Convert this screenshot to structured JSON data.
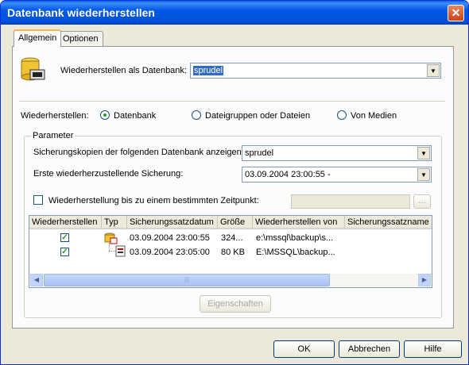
{
  "window": {
    "title": "Datenbank wiederherstellen",
    "close_glyph": "✕"
  },
  "tabs": [
    {
      "label": "Allgemein",
      "active": true
    },
    {
      "label": "Optionen",
      "active": false
    }
  ],
  "restore_as": {
    "label": "Wiederherstellen als Datenbank:",
    "value": "sprudel",
    "icon": "database-icon"
  },
  "restore_type": {
    "label": "Wiederherstellen:",
    "options": [
      {
        "label": "Datenbank",
        "selected": true
      },
      {
        "label": "Dateigruppen oder Dateien",
        "selected": false
      },
      {
        "label": "Von Medien",
        "selected": false
      }
    ]
  },
  "parameters": {
    "group_label": "Parameter",
    "show_backups_label": "Sicherungskopien der folgenden Datenbank anzeigen:",
    "show_backups_value": "sprudel",
    "first_backup_label": "Erste wiederherzustellende Sicherung:",
    "first_backup_value": "03.09.2004 23:00:55 -",
    "point_in_time_label": "Wiederherstellung bis zu einem bestimmten Zeitpunkt:",
    "point_in_time_checked": false,
    "point_in_time_value": "",
    "browse_label": "..."
  },
  "backup_table": {
    "columns": [
      "Wiederherstellen",
      "Typ",
      "Sicherungssatzdatum",
      "Größe",
      "Wiederherstellen von",
      "Sicherungssatzname"
    ],
    "rows": [
      {
        "restore": true,
        "type_icon": "full-backup-icon",
        "date": "03.09.2004 23:00:55",
        "size": "324...",
        "from": "e:\\mssql\\backup\\s...",
        "name": ""
      },
      {
        "restore": true,
        "type_icon": "log-backup-icon",
        "date": "03.09.2004 23:05:00",
        "size": "80 KB",
        "from": "E:\\MSSQL\\backup...",
        "name": ""
      }
    ],
    "scroll_thumb_glyph": "|||",
    "scroll_left_glyph": "◀",
    "scroll_right_glyph": "▶"
  },
  "properties_button": "Eigenschaften",
  "footer": {
    "ok": "OK",
    "cancel": "Abbrechen",
    "help": "Hilfe"
  },
  "colors": {
    "title_bar": "#0058e6",
    "selection": "#316ac5",
    "window_bg": "#ece9d8"
  }
}
